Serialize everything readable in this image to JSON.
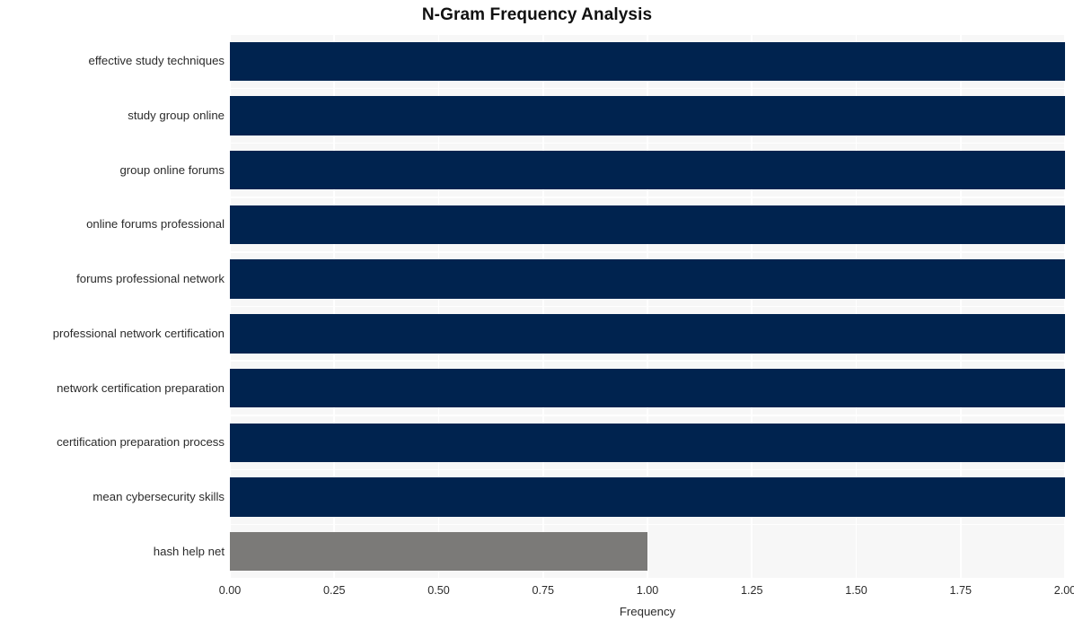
{
  "chart_data": {
    "type": "bar",
    "orientation": "horizontal",
    "title": "N-Gram Frequency Analysis",
    "xlabel": "Frequency",
    "ylabel": "",
    "xlim": [
      0,
      2
    ],
    "ylim_categories": 10,
    "grid": true,
    "legend": null,
    "categories": [
      "effective study techniques",
      "study group online",
      "group online forums",
      "online forums professional",
      "forums professional network",
      "professional network certification",
      "network certification preparation",
      "certification preparation process",
      "mean cybersecurity skills",
      "hash help net"
    ],
    "values": [
      2,
      2,
      2,
      2,
      2,
      2,
      2,
      2,
      2,
      1
    ],
    "bar_colors": [
      "#00234f",
      "#00234f",
      "#00234f",
      "#00234f",
      "#00234f",
      "#00234f",
      "#00234f",
      "#00234f",
      "#00234f",
      "#7b7a78"
    ],
    "xticks": [
      0,
      0.25,
      0.5,
      0.75,
      1.0,
      1.25,
      1.5,
      1.75,
      2.0
    ],
    "xtick_labels": [
      "0.00",
      "0.25",
      "0.50",
      "0.75",
      "1.00",
      "1.25",
      "1.50",
      "1.75",
      "2.00"
    ],
    "plot_background": "#f7f7f7",
    "figure_background": "#ffffff",
    "gridline_color": "#ffffff",
    "text_color": "#2b2b2b",
    "title_color": "#111111"
  },
  "title": {
    "text": "N-Gram Frequency Analysis"
  },
  "axes": {
    "x_label": "Frequency"
  }
}
